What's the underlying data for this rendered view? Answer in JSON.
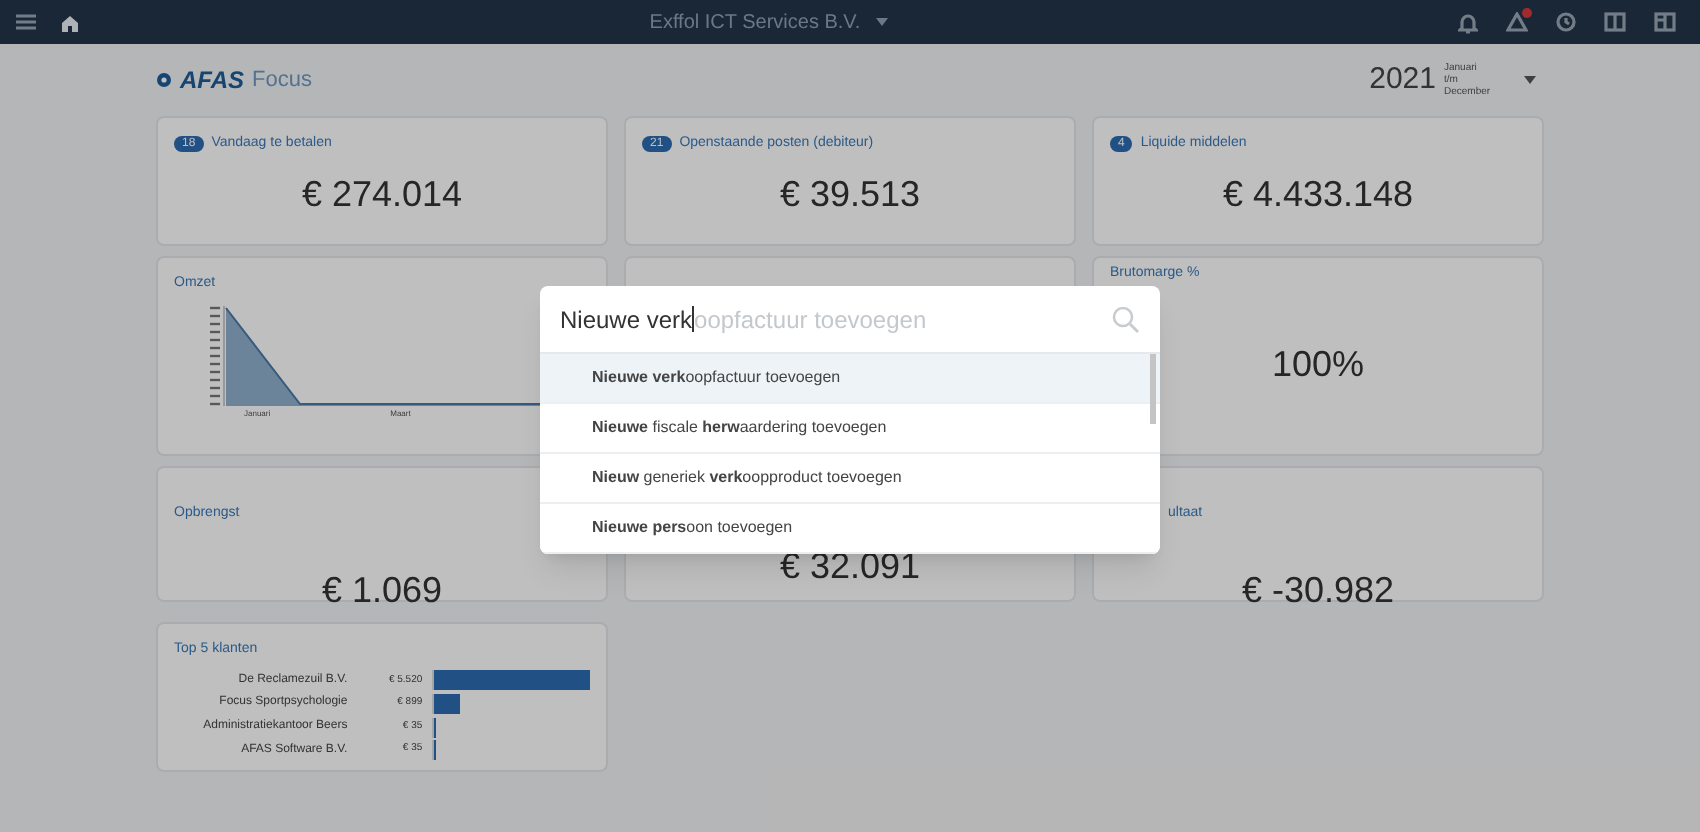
{
  "topbar": {
    "company": "Exffol ICT Services B.V.",
    "alert_badge": true
  },
  "brand": {
    "logo": "AFAS",
    "product": "Focus"
  },
  "period": {
    "year": "2021",
    "range": "Januari t/m December"
  },
  "kpi_cards": [
    {
      "badge": "18",
      "title": "Vandaag te betalen",
      "value": "€ 274.014"
    },
    {
      "badge": "21",
      "title": "Openstaande posten (debiteur)",
      "value": "€ 39.513"
    },
    {
      "badge": "4",
      "title": "Liquide middelen",
      "value": "€ 4.433.148"
    }
  ],
  "row2": [
    {
      "kind": "chart",
      "title": "Omzet",
      "x_labels": [
        "Januari",
        "Maart"
      ]
    },
    {
      "kind": "blank"
    },
    {
      "kind": "value",
      "title": "Brutomarge %",
      "value": "100%"
    }
  ],
  "row3": [
    {
      "title": "Opbrengst",
      "value": "€ 1.069"
    },
    {
      "value": "€ 32.091"
    },
    {
      "title": "ultaat",
      "value": "€ -30.982"
    }
  ],
  "top_customers": {
    "title": "Top 5 klanten",
    "rows": [
      {
        "name": "De Reclamezuil B.V.",
        "amount": "€ 5.520",
        "level": 1
      },
      {
        "name": "Focus Sportpsychologie",
        "amount": "€ 899",
        "level": 0.163
      },
      {
        "name": "Administratiekantoor Beers",
        "amount": "€ 35",
        "level": 0.006
      },
      {
        "name": "AFAS Software B.V.",
        "amount": "€ 35",
        "level": 0.006
      }
    ]
  },
  "search_dialog": {
    "query": "Nieuwe verk",
    "completion": "oopfactuur toevoegen",
    "results": [
      {
        "text": "**Nieuwe verk**oopfactuur toevoegen",
        "selected": true
      },
      {
        "text": "**Nieuwe** fiscale **herw**aardering toevoegen",
        "selected": false
      },
      {
        "text": "**Nieuw** generiek **verk**oopproduct toevoegen",
        "selected": false
      },
      {
        "text": "**Nieuwe pers**oon toevoegen",
        "selected": false
      }
    ]
  }
}
